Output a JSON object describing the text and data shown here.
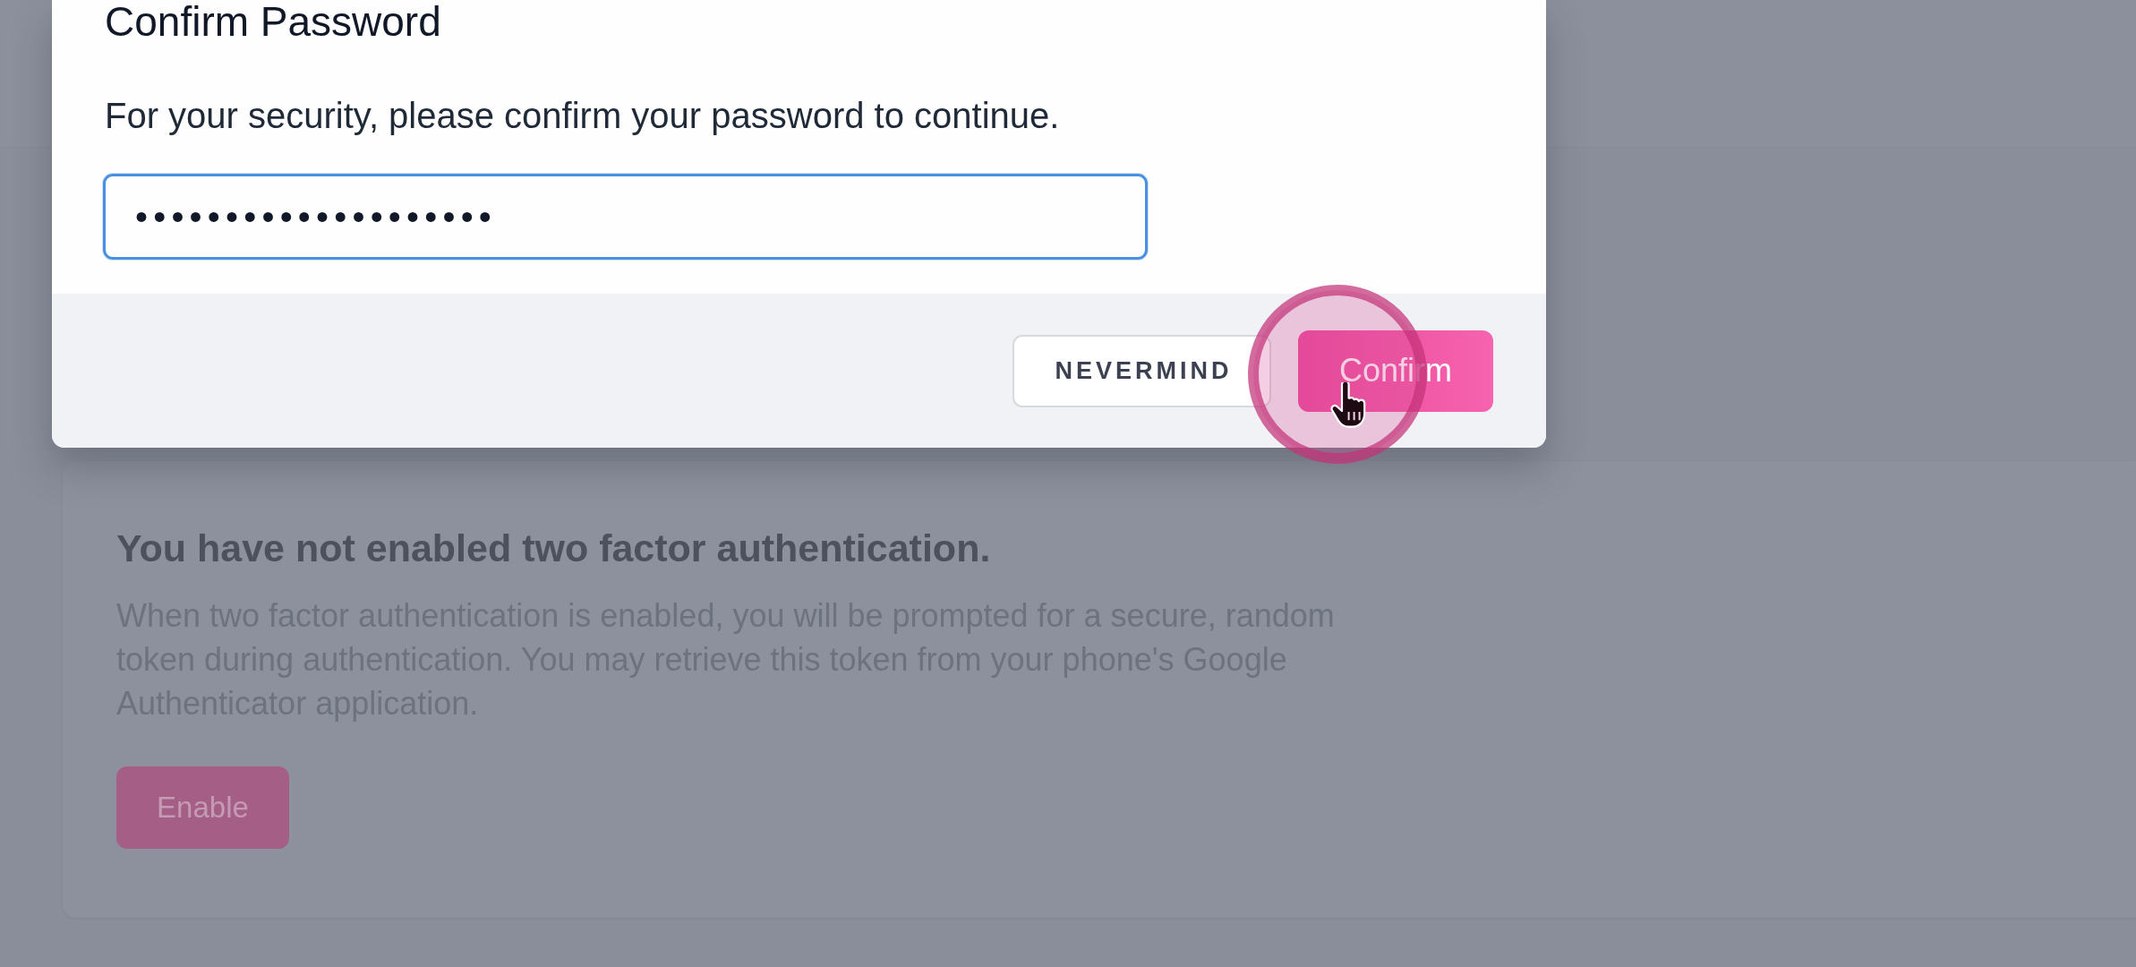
{
  "dialog": {
    "title": "Confirm Password",
    "message": "For your security, please confirm your password to continue.",
    "password_field": {
      "value": "••••••••••••••••••••",
      "focused": true
    },
    "buttons": [
      {
        "label": "NEVERMIND",
        "kind": "secondary",
        "clicked": false
      },
      {
        "label": "Confirm",
        "kind": "primary",
        "clicked": true
      }
    ]
  },
  "two_factor_card": {
    "heading": "You have not enabled two factor authentication.",
    "description": "When two factor authentication is enabled, you will be prompted for a secure, random token during authentication. You may retrieve this token from your phone's Google Authenticator application.",
    "enable_button": {
      "label": "Enable"
    }
  }
}
